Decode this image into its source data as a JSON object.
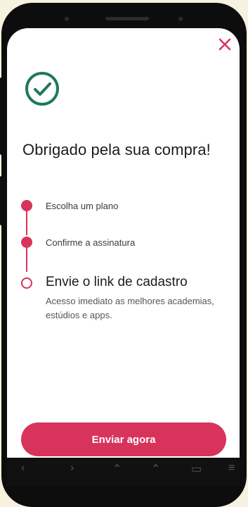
{
  "modal": {
    "close_icon": "close-icon",
    "success_icon": "check-circle-icon",
    "title": "Obrigado pela sua compra!",
    "colors": {
      "accent": "#d8335b",
      "success": "#1e7a55",
      "background": "#f7f2df"
    }
  },
  "steps": [
    {
      "label": "Escolha um plano",
      "state": "completed"
    },
    {
      "label": "Confirme a assinatura",
      "state": "completed"
    },
    {
      "label": "Envie o link de cadastro",
      "state": "current",
      "description": "Acesso imediato as melhores academias, estúdios e apps."
    }
  ],
  "actions": {
    "submit_label": "Enviar agora"
  }
}
